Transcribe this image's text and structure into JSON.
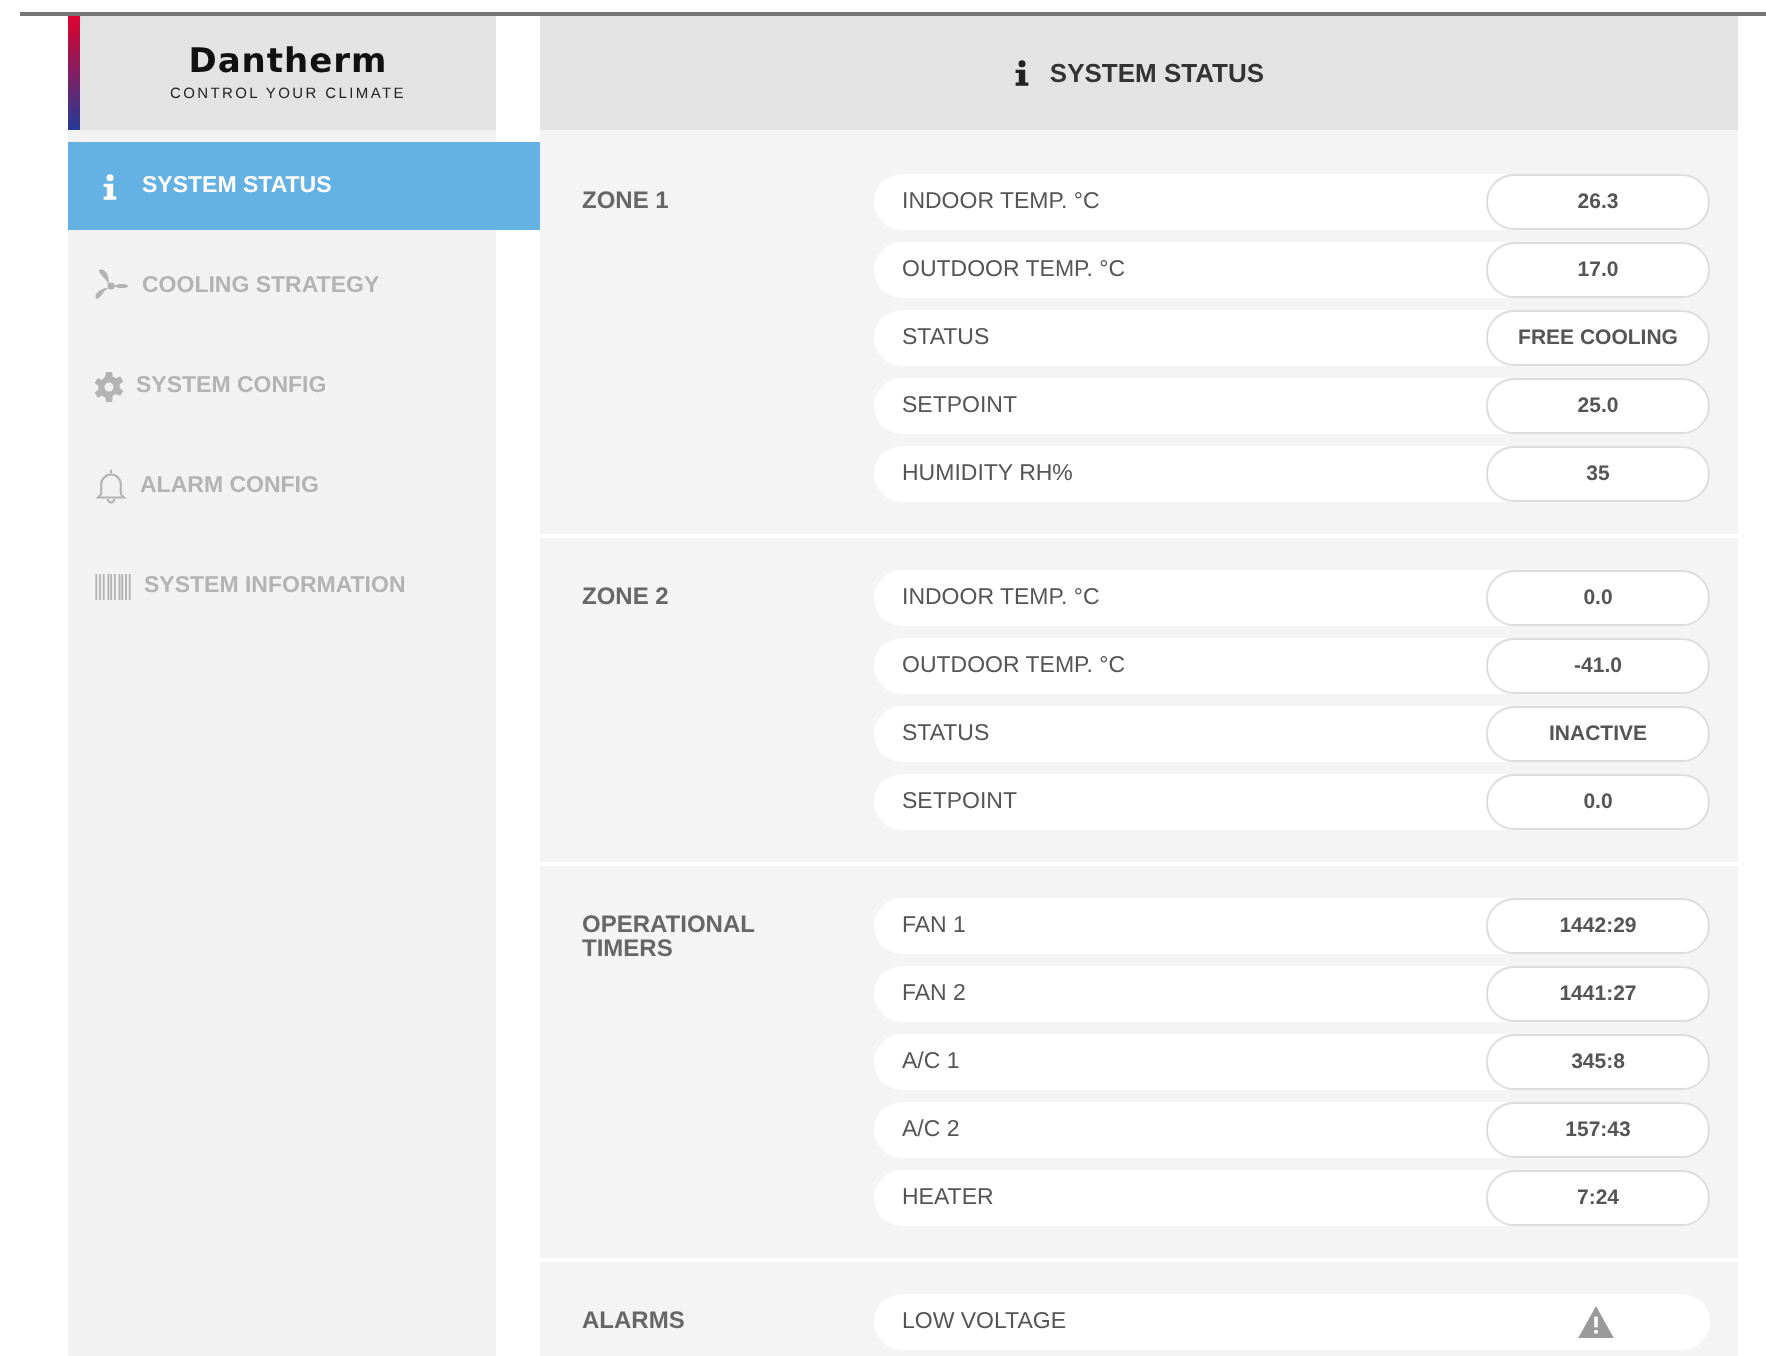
{
  "logo": {
    "name": "Dantherm",
    "tagline": "CONTROL YOUR CLIMATE"
  },
  "sidebar": {
    "items": [
      {
        "label": "SYSTEM STATUS",
        "kind": "info",
        "selected": true
      },
      {
        "label": "COOLING STRATEGY",
        "kind": "fan",
        "selected": false
      },
      {
        "label": "SYSTEM CONFIG",
        "kind": "gear",
        "selected": false
      },
      {
        "label": "ALARM CONFIG",
        "kind": "bell",
        "selected": false
      },
      {
        "label": "SYSTEM INFORMATION",
        "kind": "barcode",
        "selected": false
      }
    ]
  },
  "header": {
    "title": "SYSTEM STATUS"
  },
  "sections": [
    {
      "title": "ZONE 1",
      "rows": [
        {
          "kind": "value",
          "label": "INDOOR TEMP. °C",
          "value": "26.3"
        },
        {
          "kind": "value",
          "label": "OUTDOOR TEMP. °C",
          "value": "17.0"
        },
        {
          "kind": "value",
          "label": "STATUS",
          "value": "FREE COOLING"
        },
        {
          "kind": "value",
          "label": "SETPOINT",
          "value": "25.0"
        },
        {
          "kind": "value",
          "label": "HUMIDITY RH%",
          "value": "35"
        }
      ]
    },
    {
      "title": "ZONE 2",
      "rows": [
        {
          "kind": "value",
          "label": "INDOOR TEMP. °C",
          "value": "0.0"
        },
        {
          "kind": "value",
          "label": "OUTDOOR TEMP. °C",
          "value": "-41.0"
        },
        {
          "kind": "value",
          "label": "STATUS",
          "value": "INACTIVE"
        },
        {
          "kind": "value",
          "label": "SETPOINT",
          "value": "0.0"
        }
      ]
    },
    {
      "title": "OPERATIONAL TIMERS",
      "rows": [
        {
          "kind": "value",
          "label": "FAN 1",
          "value": "1442:29"
        },
        {
          "kind": "value",
          "label": "FAN 2",
          "value": "1441:27"
        },
        {
          "kind": "value",
          "label": "A/C 1",
          "value": "345:8"
        },
        {
          "kind": "value",
          "label": "A/C 2",
          "value": "157:43"
        },
        {
          "kind": "value",
          "label": "HEATER",
          "value": "7:24"
        }
      ]
    },
    {
      "title": "ALARMS",
      "rows": [
        {
          "kind": "alarm",
          "label": "LOW VOLTAGE"
        }
      ]
    }
  ]
}
